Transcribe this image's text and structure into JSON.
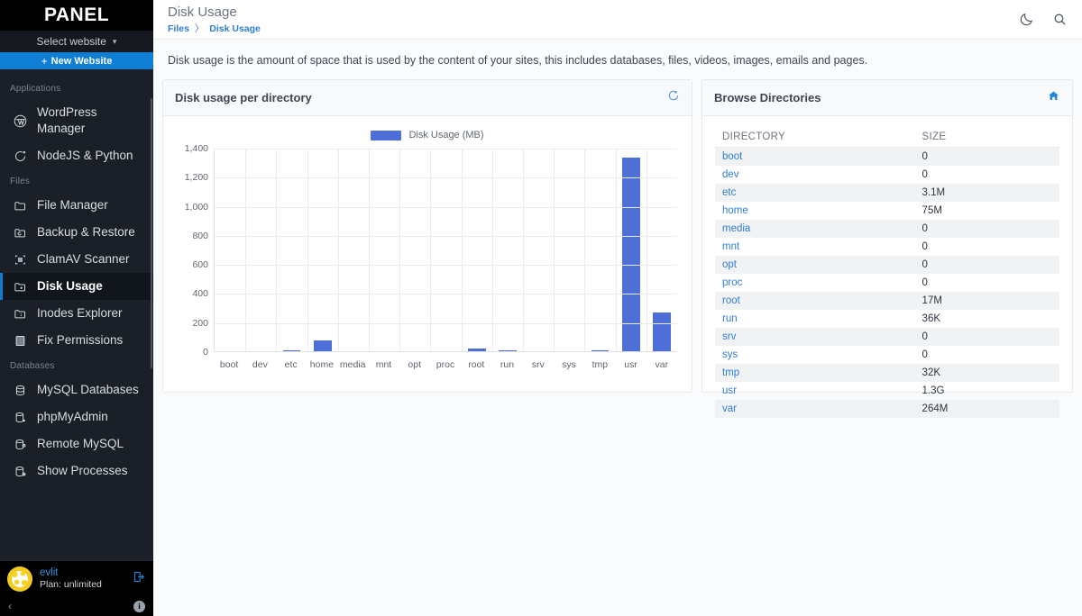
{
  "sidebar": {
    "brand": "PANEL",
    "select_website": {
      "label": "Select website",
      "caret": "chevron-down-icon"
    },
    "new_website": {
      "plus": "+",
      "label": "New Website"
    },
    "groups": [
      {
        "label": "Applications",
        "items": [
          {
            "label": "WordPress Manager",
            "icon": "wordpress-icon",
            "active": false
          },
          {
            "label": "NodeJS & Python",
            "icon": "nodejs-icon",
            "active": false
          }
        ]
      },
      {
        "label": "Files",
        "items": [
          {
            "label": "File Manager",
            "icon": "folder-icon",
            "active": false
          },
          {
            "label": "Backup & Restore",
            "icon": "folder-backup-icon",
            "active": false
          },
          {
            "label": "ClamAV Scanner",
            "icon": "scanner-icon",
            "active": false
          },
          {
            "label": "Disk Usage",
            "icon": "folder-disk-icon",
            "active": true
          },
          {
            "label": "Inodes Explorer",
            "icon": "folder-inodes-icon",
            "active": false
          },
          {
            "label": "Fix Permissions",
            "icon": "permissions-icon",
            "active": false
          }
        ]
      },
      {
        "label": "Databases",
        "items": [
          {
            "label": "MySQL Databases",
            "icon": "database-icon",
            "active": false
          },
          {
            "label": "phpMyAdmin",
            "icon": "database-admin-icon",
            "active": false
          },
          {
            "label": "Remote MySQL",
            "icon": "database-remote-icon",
            "active": false
          },
          {
            "label": "Show Processes",
            "icon": "database-processes-icon",
            "active": false
          }
        ]
      }
    ],
    "user": {
      "name": "evlit",
      "plan": "Plan: unlimited",
      "logout_icon": "logout-icon"
    },
    "footer": {
      "collapse": "‹",
      "info": "i"
    }
  },
  "header": {
    "title": "Disk Usage",
    "breadcrumb": {
      "parent": "Files",
      "separator": "〉",
      "current": "Disk Usage"
    },
    "icons": [
      {
        "name": "dark-mode-icon"
      },
      {
        "name": "search-icon"
      }
    ]
  },
  "description": "Disk usage is the amount of space that is used by the content of your sites, this includes databases, files, videos, images, emails and pages.",
  "chart_panel": {
    "title": "Disk usage per directory",
    "refresh_icon": "refresh-icon"
  },
  "table_panel": {
    "title": "Browse Directories",
    "home_icon": "home-icon",
    "columns": [
      "DIRECTORY",
      "SIZE"
    ],
    "rows": [
      {
        "directory": "boot",
        "size": "0"
      },
      {
        "directory": "dev",
        "size": "0"
      },
      {
        "directory": "etc",
        "size": "3.1M"
      },
      {
        "directory": "home",
        "size": "75M"
      },
      {
        "directory": "media",
        "size": "0"
      },
      {
        "directory": "mnt",
        "size": "0"
      },
      {
        "directory": "opt",
        "size": "0"
      },
      {
        "directory": "proc",
        "size": "0"
      },
      {
        "directory": "root",
        "size": "17M"
      },
      {
        "directory": "run",
        "size": "36K"
      },
      {
        "directory": "srv",
        "size": "0"
      },
      {
        "directory": "sys",
        "size": "0"
      },
      {
        "directory": "tmp",
        "size": "32K"
      },
      {
        "directory": "usr",
        "size": "1.3G"
      },
      {
        "directory": "var",
        "size": "264M"
      }
    ]
  },
  "chart_data": {
    "type": "bar",
    "title": "Disk usage per directory",
    "xlabel": "",
    "ylabel": "",
    "ylim": [
      0,
      1400
    ],
    "yticks": [
      0,
      200,
      400,
      600,
      800,
      1000,
      1200,
      1400
    ],
    "ytick_labels": [
      "0",
      "200",
      "400",
      "600",
      "800",
      "1,000",
      "1,200",
      "1,400"
    ],
    "grid": true,
    "legend_position": "top-center",
    "bar_color": "#4f6fd8",
    "categories": [
      "boot",
      "dev",
      "etc",
      "home",
      "media",
      "mnt",
      "opt",
      "proc",
      "root",
      "run",
      "srv",
      "sys",
      "tmp",
      "usr",
      "var"
    ],
    "series": [
      {
        "name": "Disk Usage (MB)",
        "values": [
          0,
          0,
          3.1,
          75,
          0,
          0,
          0,
          0,
          17,
          0.036,
          0,
          0,
          0.032,
          1331,
          264
        ]
      }
    ]
  },
  "colors": {
    "accent_blue": "#0e7fd4",
    "bar_blue": "#4f6fd8",
    "link_blue": "#2f7dd1",
    "sidebar_bg": "#1b2028",
    "page_bg": "#fafbfd"
  }
}
